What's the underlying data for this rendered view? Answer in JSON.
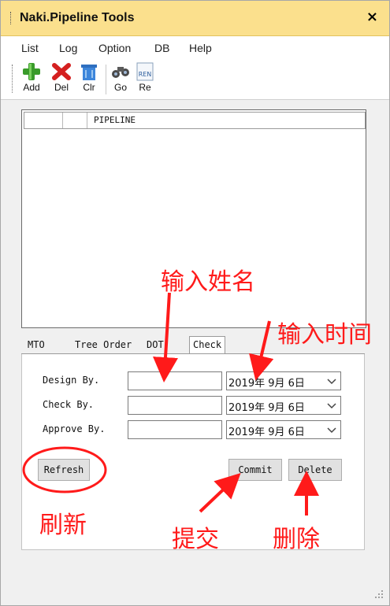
{
  "window": {
    "title": "Naki.Pipeline Tools",
    "close_glyph": "×"
  },
  "menu": [
    "List",
    "Log",
    "Option",
    "DB",
    "Help"
  ],
  "toolbar": {
    "add": "Add",
    "del": "Del",
    "clr": "Clr",
    "go": "Go",
    "re": "Re",
    "re_icon_text": "REN"
  },
  "listview": {
    "columns": [
      "",
      "",
      "PIPELINE"
    ]
  },
  "tabs": {
    "items": [
      "MTO",
      "Tree Order",
      "DOT",
      "Check"
    ],
    "active": "Check"
  },
  "check_form": {
    "design_label": "Design By.",
    "check_label": "Check By.",
    "approve_label": "Approve By.",
    "design_value": "",
    "check_value": "",
    "approve_value": "",
    "design_date": "2019年 9月 6日",
    "check_date": "2019年 9月 6日",
    "approve_date": "2019年 9月 6日"
  },
  "buttons": {
    "refresh": "Refresh",
    "commit": "Commit",
    "delete": "Delete"
  },
  "annotations": {
    "enter_name": "输入姓名",
    "enter_time": "输入时间",
    "refresh": "刷新",
    "submit": "提交",
    "delete": "删除"
  },
  "colors": {
    "title_bar": "#fbe08d",
    "annotation_red": "#ff1a1a"
  },
  "icons": {
    "add": "plus-icon",
    "del": "x-icon",
    "clr": "bin-icon",
    "go": "binoculars-icon",
    "re": "ren-icon"
  }
}
